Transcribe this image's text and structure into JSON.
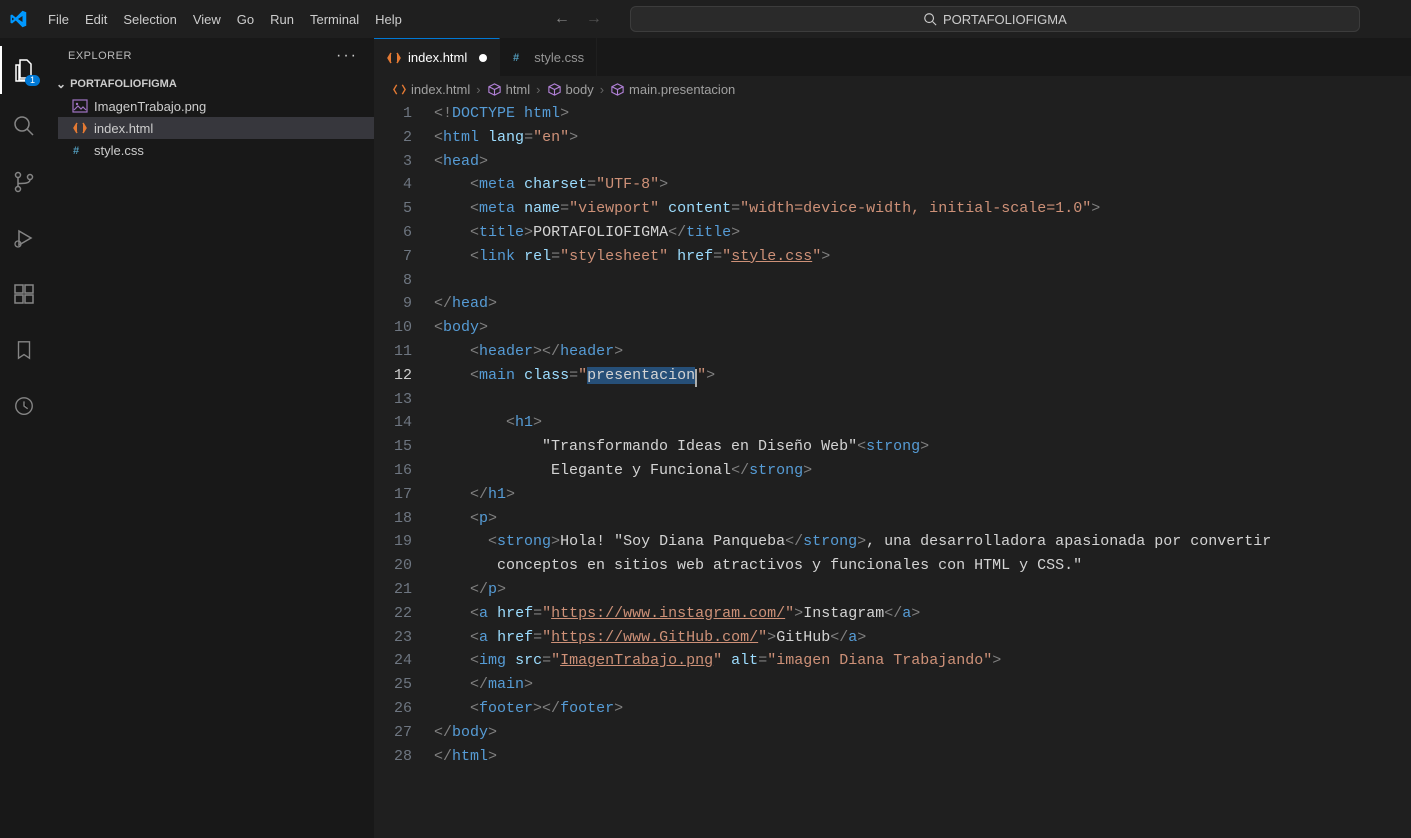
{
  "menu": [
    "File",
    "Edit",
    "Selection",
    "View",
    "Go",
    "Run",
    "Terminal",
    "Help"
  ],
  "search": {
    "placeholder": "PORTAFOLIOFIGMA"
  },
  "activity": {
    "explorer_badge": "1"
  },
  "sidebar": {
    "title": "EXPLORER",
    "project": "PORTAFOLIOFIGMA",
    "files": [
      {
        "name": "ImagenTrabajo.png",
        "icon": "image"
      },
      {
        "name": "index.html",
        "icon": "html",
        "active": true
      },
      {
        "name": "style.css",
        "icon": "css"
      }
    ]
  },
  "tabs": [
    {
      "name": "index.html",
      "icon": "html",
      "active": true,
      "dirty": true
    },
    {
      "name": "style.css",
      "icon": "css",
      "active": false,
      "dirty": false
    }
  ],
  "breadcrumb": [
    {
      "icon": "html-file",
      "label": "index.html"
    },
    {
      "icon": "cube",
      "label": "html"
    },
    {
      "icon": "cube",
      "label": "body"
    },
    {
      "icon": "cube",
      "label": "main.presentacion"
    }
  ],
  "code": {
    "active_line": 12,
    "lines": [
      [
        {
          "t": "punc",
          "v": "<!"
        },
        {
          "t": "doctype",
          "v": "DOCTYPE"
        },
        {
          "t": "text",
          "v": " "
        },
        {
          "t": "doctype",
          "v": "html"
        },
        {
          "t": "punc",
          "v": ">"
        }
      ],
      [
        {
          "t": "punc",
          "v": "<"
        },
        {
          "t": "tag",
          "v": "html"
        },
        {
          "t": "text",
          "v": " "
        },
        {
          "t": "attr",
          "v": "lang"
        },
        {
          "t": "punc",
          "v": "="
        },
        {
          "t": "str",
          "v": "\"en\""
        },
        {
          "t": "punc",
          "v": ">"
        }
      ],
      [
        {
          "t": "punc",
          "v": "<"
        },
        {
          "t": "tag",
          "v": "head"
        },
        {
          "t": "punc",
          "v": ">"
        }
      ],
      [
        {
          "t": "text",
          "v": "    "
        },
        {
          "t": "punc",
          "v": "<"
        },
        {
          "t": "tag",
          "v": "meta"
        },
        {
          "t": "text",
          "v": " "
        },
        {
          "t": "attr",
          "v": "charset"
        },
        {
          "t": "punc",
          "v": "="
        },
        {
          "t": "str",
          "v": "\"UTF-8\""
        },
        {
          "t": "punc",
          "v": ">"
        }
      ],
      [
        {
          "t": "text",
          "v": "    "
        },
        {
          "t": "punc",
          "v": "<"
        },
        {
          "t": "tag",
          "v": "meta"
        },
        {
          "t": "text",
          "v": " "
        },
        {
          "t": "attr",
          "v": "name"
        },
        {
          "t": "punc",
          "v": "="
        },
        {
          "t": "str",
          "v": "\"viewport\""
        },
        {
          "t": "text",
          "v": " "
        },
        {
          "t": "attr",
          "v": "content"
        },
        {
          "t": "punc",
          "v": "="
        },
        {
          "t": "str",
          "v": "\"width=device-width, initial-scale=1.0\""
        },
        {
          "t": "punc",
          "v": ">"
        }
      ],
      [
        {
          "t": "text",
          "v": "    "
        },
        {
          "t": "punc",
          "v": "<"
        },
        {
          "t": "tag",
          "v": "title"
        },
        {
          "t": "punc",
          "v": ">"
        },
        {
          "t": "text",
          "v": "PORTAFOLIOFIGMA"
        },
        {
          "t": "punc",
          "v": "</"
        },
        {
          "t": "tag",
          "v": "title"
        },
        {
          "t": "punc",
          "v": ">"
        }
      ],
      [
        {
          "t": "text",
          "v": "    "
        },
        {
          "t": "punc",
          "v": "<"
        },
        {
          "t": "tag",
          "v": "link"
        },
        {
          "t": "text",
          "v": " "
        },
        {
          "t": "attr",
          "v": "rel"
        },
        {
          "t": "punc",
          "v": "="
        },
        {
          "t": "str",
          "v": "\"stylesheet\""
        },
        {
          "t": "text",
          "v": " "
        },
        {
          "t": "attr",
          "v": "href"
        },
        {
          "t": "punc",
          "v": "="
        },
        {
          "t": "str",
          "v": "\""
        },
        {
          "t": "link",
          "v": "style.css"
        },
        {
          "t": "str",
          "v": "\""
        },
        {
          "t": "punc",
          "v": ">"
        }
      ],
      [],
      [
        {
          "t": "punc",
          "v": "</"
        },
        {
          "t": "tag",
          "v": "head"
        },
        {
          "t": "punc",
          "v": ">"
        }
      ],
      [
        {
          "t": "punc",
          "v": "<"
        },
        {
          "t": "tag",
          "v": "body"
        },
        {
          "t": "punc",
          "v": ">"
        }
      ],
      [
        {
          "t": "text",
          "v": "    "
        },
        {
          "t": "punc",
          "v": "<"
        },
        {
          "t": "tag",
          "v": "header"
        },
        {
          "t": "punc",
          "v": "></"
        },
        {
          "t": "tag",
          "v": "header"
        },
        {
          "t": "punc",
          "v": ">"
        }
      ],
      [
        {
          "t": "text",
          "v": "    "
        },
        {
          "t": "punc",
          "v": "<"
        },
        {
          "t": "tag",
          "v": "main"
        },
        {
          "t": "text",
          "v": " "
        },
        {
          "t": "attr",
          "v": "class"
        },
        {
          "t": "punc",
          "v": "="
        },
        {
          "t": "str",
          "v": "\""
        },
        {
          "t": "sel",
          "v": "presentacion"
        },
        {
          "t": "cursor",
          "v": ""
        },
        {
          "t": "str",
          "v": "\""
        },
        {
          "t": "punc",
          "v": ">"
        }
      ],
      [
        {
          "t": "text",
          "v": "    "
        }
      ],
      [
        {
          "t": "text",
          "v": "        "
        },
        {
          "t": "punc",
          "v": "<"
        },
        {
          "t": "tag",
          "v": "h1"
        },
        {
          "t": "punc",
          "v": ">"
        }
      ],
      [
        {
          "t": "text",
          "v": "            \"Transformando Ideas en Diseño Web\""
        },
        {
          "t": "punc",
          "v": "<"
        },
        {
          "t": "tag",
          "v": "strong"
        },
        {
          "t": "punc",
          "v": ">"
        }
      ],
      [
        {
          "t": "text",
          "v": "             Elegante y Funcional"
        },
        {
          "t": "punc",
          "v": "</"
        },
        {
          "t": "tag",
          "v": "strong"
        },
        {
          "t": "punc",
          "v": ">"
        }
      ],
      [
        {
          "t": "text",
          "v": "    "
        },
        {
          "t": "punc",
          "v": "</"
        },
        {
          "t": "tag",
          "v": "h1"
        },
        {
          "t": "punc",
          "v": ">"
        }
      ],
      [
        {
          "t": "text",
          "v": "    "
        },
        {
          "t": "punc",
          "v": "<"
        },
        {
          "t": "tag",
          "v": "p"
        },
        {
          "t": "punc",
          "v": ">"
        }
      ],
      [
        {
          "t": "text",
          "v": "      "
        },
        {
          "t": "punc",
          "v": "<"
        },
        {
          "t": "tag",
          "v": "strong"
        },
        {
          "t": "punc",
          "v": ">"
        },
        {
          "t": "text",
          "v": "Hola! \"Soy Diana Panqueba"
        },
        {
          "t": "punc",
          "v": "</"
        },
        {
          "t": "tag",
          "v": "strong"
        },
        {
          "t": "punc",
          "v": ">"
        },
        {
          "t": "text",
          "v": ", una desarrolladora apasionada por convertir"
        }
      ],
      [
        {
          "t": "text",
          "v": "       conceptos en sitios web atractivos y funcionales con HTML y CSS.\""
        }
      ],
      [
        {
          "t": "text",
          "v": "    "
        },
        {
          "t": "punc",
          "v": "</"
        },
        {
          "t": "tag",
          "v": "p"
        },
        {
          "t": "punc",
          "v": ">"
        }
      ],
      [
        {
          "t": "text",
          "v": "    "
        },
        {
          "t": "punc",
          "v": "<"
        },
        {
          "t": "tag",
          "v": "a"
        },
        {
          "t": "text",
          "v": " "
        },
        {
          "t": "attr",
          "v": "href"
        },
        {
          "t": "punc",
          "v": "="
        },
        {
          "t": "str",
          "v": "\""
        },
        {
          "t": "link",
          "v": "https://www.instagram.com/"
        },
        {
          "t": "str",
          "v": "\""
        },
        {
          "t": "punc",
          "v": ">"
        },
        {
          "t": "text",
          "v": "Instagram"
        },
        {
          "t": "punc",
          "v": "</"
        },
        {
          "t": "tag",
          "v": "a"
        },
        {
          "t": "punc",
          "v": ">"
        }
      ],
      [
        {
          "t": "text",
          "v": "    "
        },
        {
          "t": "punc",
          "v": "<"
        },
        {
          "t": "tag",
          "v": "a"
        },
        {
          "t": "text",
          "v": " "
        },
        {
          "t": "attr",
          "v": "href"
        },
        {
          "t": "punc",
          "v": "="
        },
        {
          "t": "str",
          "v": "\""
        },
        {
          "t": "link",
          "v": "https://www.GitHub.com/"
        },
        {
          "t": "str",
          "v": "\""
        },
        {
          "t": "punc",
          "v": ">"
        },
        {
          "t": "text",
          "v": "GitHub"
        },
        {
          "t": "punc",
          "v": "</"
        },
        {
          "t": "tag",
          "v": "a"
        },
        {
          "t": "punc",
          "v": ">"
        }
      ],
      [
        {
          "t": "text",
          "v": "    "
        },
        {
          "t": "punc",
          "v": "<"
        },
        {
          "t": "tag",
          "v": "img"
        },
        {
          "t": "text",
          "v": " "
        },
        {
          "t": "attr",
          "v": "src"
        },
        {
          "t": "punc",
          "v": "="
        },
        {
          "t": "str",
          "v": "\""
        },
        {
          "t": "link",
          "v": "ImagenTrabajo.png"
        },
        {
          "t": "str",
          "v": "\""
        },
        {
          "t": "text",
          "v": " "
        },
        {
          "t": "attr",
          "v": "alt"
        },
        {
          "t": "punc",
          "v": "="
        },
        {
          "t": "str",
          "v": "\"imagen Diana Trabajando\""
        },
        {
          "t": "punc",
          "v": ">"
        }
      ],
      [
        {
          "t": "text",
          "v": "    "
        },
        {
          "t": "punc",
          "v": "</"
        },
        {
          "t": "tag",
          "v": "main"
        },
        {
          "t": "punc",
          "v": ">"
        }
      ],
      [
        {
          "t": "text",
          "v": "    "
        },
        {
          "t": "punc",
          "v": "<"
        },
        {
          "t": "tag",
          "v": "footer"
        },
        {
          "t": "punc",
          "v": "></"
        },
        {
          "t": "tag",
          "v": "footer"
        },
        {
          "t": "punc",
          "v": ">"
        }
      ],
      [
        {
          "t": "punc",
          "v": "</"
        },
        {
          "t": "tag",
          "v": "body"
        },
        {
          "t": "punc",
          "v": ">"
        }
      ],
      [
        {
          "t": "punc",
          "v": "</"
        },
        {
          "t": "tag",
          "v": "html"
        },
        {
          "t": "punc",
          "v": ">"
        }
      ]
    ]
  }
}
